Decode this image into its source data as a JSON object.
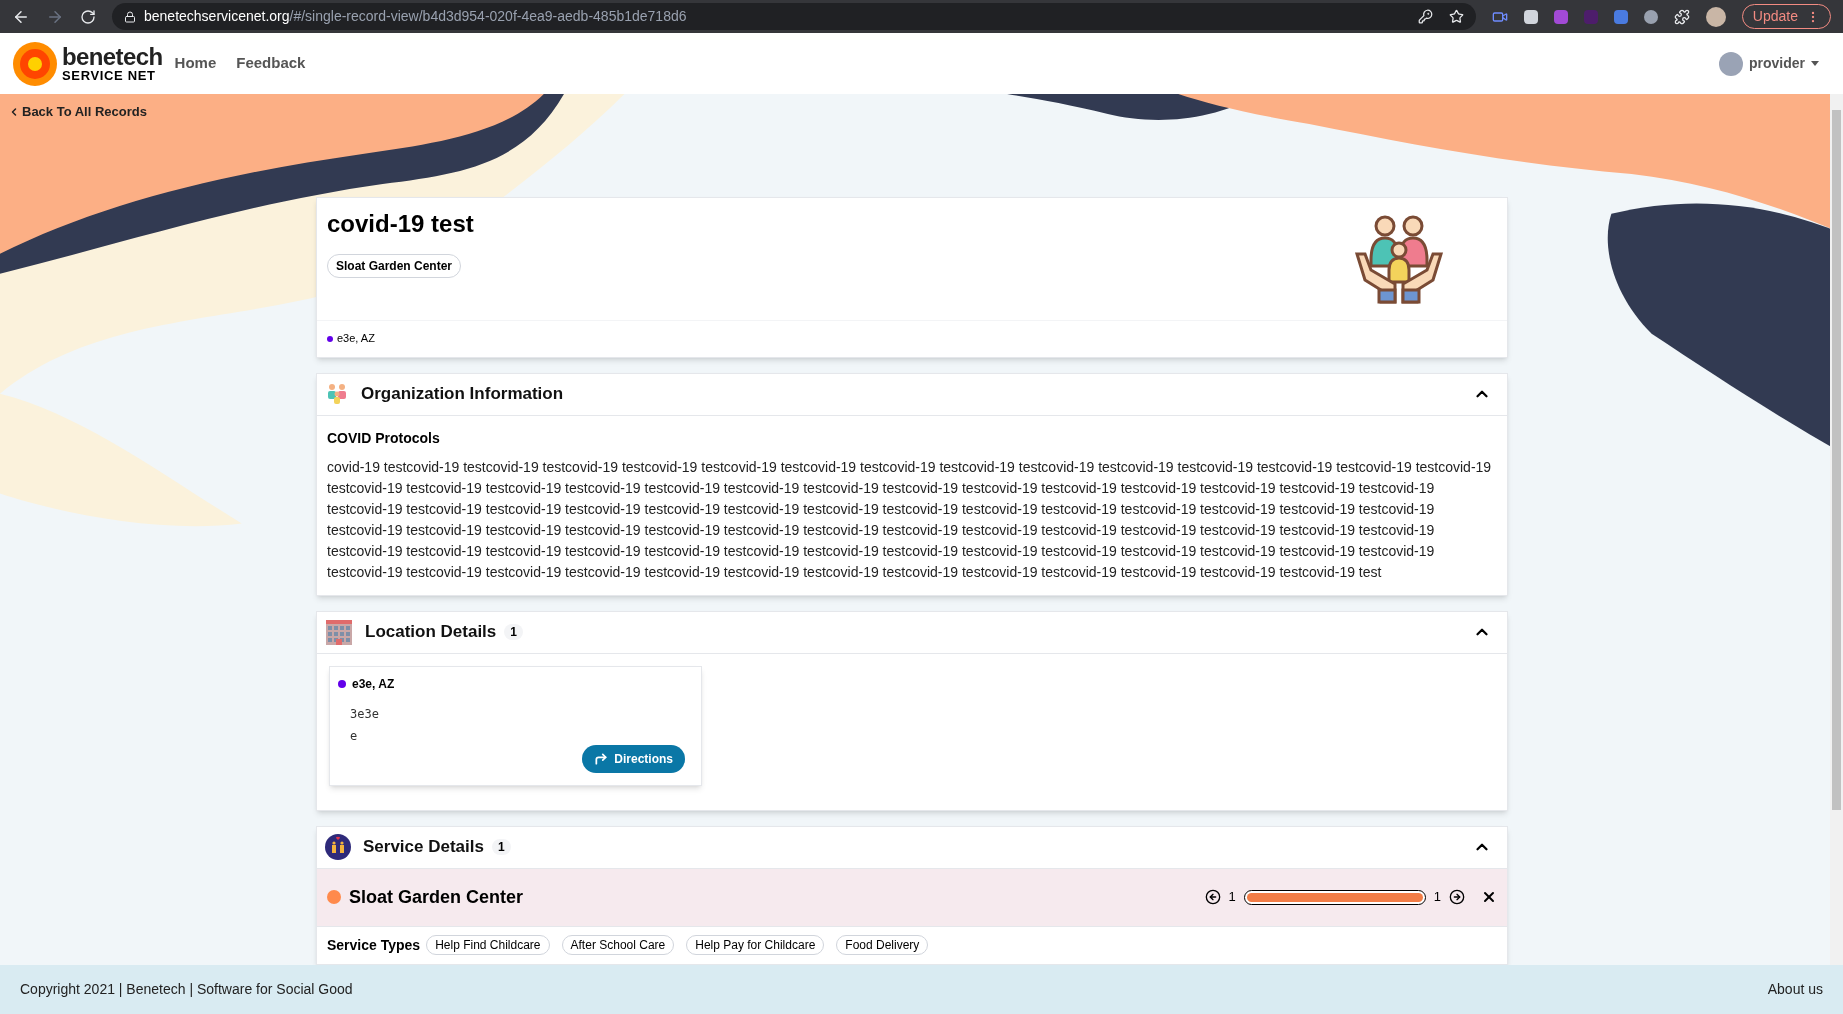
{
  "browser": {
    "url_host": "benetechservicenet.org",
    "url_path": "/#/single-record-view/b4d3d954-020f-4ea9-aedb-485b1de718d6",
    "update_label": "Update"
  },
  "nav": {
    "logo_top": "benetech",
    "logo_bottom": "SERVICE NET",
    "links": [
      {
        "label": "Home"
      },
      {
        "label": "Feedback"
      }
    ],
    "user": "provider"
  },
  "back_link": "Back To All Records",
  "record": {
    "title": "covid-19 test",
    "organization_tag": "Sloat Garden Center",
    "location": {
      "label": "e3e, AZ",
      "color": "#6200ea"
    }
  },
  "sections": [
    {
      "kind": "organization",
      "title": "Organization Information",
      "expanded": true,
      "heading": "COVID Protocols",
      "text": "covid-19 testcovid-19 testcovid-19 testcovid-19 testcovid-19 testcovid-19 testcovid-19 testcovid-19 testcovid-19 testcovid-19 testcovid-19 testcovid-19 testcovid-19 testcovid-19 testcovid-19 testcovid-19 testcovid-19 testcovid-19 testcovid-19 testcovid-19 testcovid-19 testcovid-19 testcovid-19 testcovid-19 testcovid-19 testcovid-19 testcovid-19 testcovid-19 testcovid-19 testcovid-19 testcovid-19 testcovid-19 testcovid-19 testcovid-19 testcovid-19 testcovid-19 testcovid-19 testcovid-19 testcovid-19 testcovid-19 testcovid-19 testcovid-19 testcovid-19 testcovid-19 testcovid-19 testcovid-19 testcovid-19 testcovid-19 testcovid-19 testcovid-19 testcovid-19 testcovid-19 testcovid-19 testcovid-19 testcovid-19 testcovid-19 testcovid-19 testcovid-19 testcovid-19 testcovid-19 testcovid-19 testcovid-19 testcovid-19 testcovid-19 testcovid-19 testcovid-19 testcovid-19 testcovid-19 testcovid-19 testcovid-19 testcovid-19 testcovid-19 testcovid-19 testcovid-19 testcovid-19 testcovid-19 testcovid-19 testcovid-19 testcovid-19 testcovid-19 testcovid-19 testcovid-19 testcovid-19 testcovid-19 test"
    },
    {
      "kind": "locations",
      "title": "Location Details",
      "count": "1",
      "expanded": true,
      "locations": [
        {
          "label": "e3e, AZ",
          "color": "#6200ea",
          "address_lines": [
            "3e3e",
            "e"
          ],
          "button": "Directions"
        }
      ]
    },
    {
      "kind": "services",
      "title": "Service Details",
      "count": "1",
      "expanded": true,
      "service": {
        "name": "Sloat Garden Center",
        "color": "#ff8a4c",
        "page": "1",
        "total": "1",
        "level": 1,
        "types_label": "Service Types",
        "types": [
          "Help Find Childcare",
          "After School Care",
          "Help Pay for Childcare",
          "Food Delivery"
        ]
      }
    }
  ],
  "footer": {
    "copyright": "Copyright 2021 | Benetech | Software for Social Good",
    "about": "About us"
  }
}
